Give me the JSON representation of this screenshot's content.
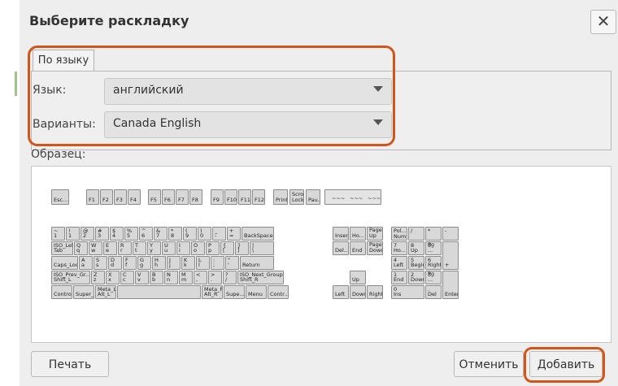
{
  "dialog": {
    "title": "Выберите раскладку",
    "close": "✕"
  },
  "tab": {
    "label": "По языку"
  },
  "language": {
    "label": "Язык:",
    "value": "английский"
  },
  "variant": {
    "label": "Варианты:",
    "value": "Canada English"
  },
  "sample": {
    "label": "Образец:"
  },
  "buttons": {
    "print": "Печать",
    "cancel": "Отменить",
    "add": "Добавить"
  },
  "keyboard": {
    "fnrow": [
      "Esc...",
      "F1",
      "F2",
      "F3",
      "F4",
      "F5",
      "F6",
      "F7",
      "F8",
      "F9",
      "F10",
      "F11",
      "F12",
      "Print",
      "Scroll Lock",
      "Pau..."
    ],
    "row1": [
      [
        "~",
        "1"
      ],
      [
        "!",
        "1"
      ],
      [
        "@",
        "2"
      ],
      [
        "#",
        "3"
      ],
      [
        "$",
        "4"
      ],
      [
        "%",
        "5"
      ],
      [
        "^",
        "6"
      ],
      [
        "&",
        "7"
      ],
      [
        "*",
        "8"
      ],
      [
        "(",
        "9"
      ],
      [
        ")",
        "0"
      ],
      [
        "_",
        "-"
      ],
      [
        "+",
        "="
      ],
      [
        "",
        "BackSpace"
      ]
    ],
    "row2": [
      [
        "ISO_Lef...",
        "Tab"
      ],
      [
        "Q",
        "q"
      ],
      [
        "W",
        "w"
      ],
      [
        "E",
        "e"
      ],
      [
        "R",
        "r"
      ],
      [
        "T",
        "t"
      ],
      [
        "Y",
        "y"
      ],
      [
        "U",
        "u"
      ],
      [
        "I",
        "i"
      ],
      [
        "O",
        "o"
      ],
      [
        "P",
        "p"
      ],
      [
        "{",
        "["
      ],
      [
        "}",
        "]"
      ],
      [
        "|",
        "\\"
      ]
    ],
    "row3": [
      [
        "",
        "Caps_Lock"
      ],
      [
        "A",
        "a"
      ],
      [
        "S",
        "s"
      ],
      [
        "D",
        "d"
      ],
      [
        "F",
        "f"
      ],
      [
        "G",
        "g"
      ],
      [
        "H",
        "h"
      ],
      [
        "J",
        "j"
      ],
      [
        "K",
        "k"
      ],
      [
        "L",
        "l"
      ],
      [
        ":",
        ";"
      ],
      [
        "\"",
        "'"
      ],
      [
        "",
        "Return"
      ]
    ],
    "row4": [
      [
        "ISO_Prev_Gr...",
        "Shift_L"
      ],
      [
        "Z",
        "z"
      ],
      [
        "X",
        "x"
      ],
      [
        "C",
        "c"
      ],
      [
        "V",
        "v"
      ],
      [
        "B",
        "b"
      ],
      [
        "N",
        "n"
      ],
      [
        "M",
        "m"
      ],
      [
        "<",
        ","
      ],
      [
        ">",
        "."
      ],
      [
        "?",
        "/"
      ],
      [
        "ISO_Next_Group",
        "Shift_R"
      ]
    ],
    "row5": [
      [
        "",
        "Control_L"
      ],
      [
        "",
        "Super_L"
      ],
      [
        "Meta_L",
        "Alt_L"
      ],
      [
        "",
        ""
      ],
      [
        "Meta_R",
        "Alt_R"
      ],
      [
        "",
        "Supe..."
      ],
      [
        "",
        "Menu"
      ],
      [
        "",
        "Contr..."
      ]
    ],
    "nav1": [
      "Insert",
      "Ho...",
      "Page Up"
    ],
    "nav2": [
      "Del...",
      "End",
      "Page Down"
    ],
    "up": "Up",
    "arrows": [
      "Left",
      "Down",
      "Right"
    ],
    "num1": [
      [
        "Pol... Num Lock",
        ""
      ],
      [
        "/",
        ""
      ],
      [
        "*",
        ""
      ],
      [
        "-",
        ""
      ]
    ],
    "num2": [
      [
        "7",
        "Ho..."
      ],
      [
        "8",
        "Up"
      ],
      [
        "9",
        "Pg ..."
      ]
    ],
    "num3": [
      [
        "4",
        "Left"
      ],
      [
        "5",
        "Begin"
      ],
      [
        "6",
        "Right"
      ]
    ],
    "num4": [
      [
        "1",
        "End"
      ],
      [
        "2",
        "Down"
      ],
      [
        "3",
        "Pg ..."
      ]
    ],
    "num5": [
      [
        "0",
        "Ins"
      ],
      [
        ".",
        "Del"
      ]
    ],
    "numplus": "+",
    "numenter": "Enter",
    "leds": [
      "~~~",
      "~~~",
      "~~~"
    ]
  }
}
